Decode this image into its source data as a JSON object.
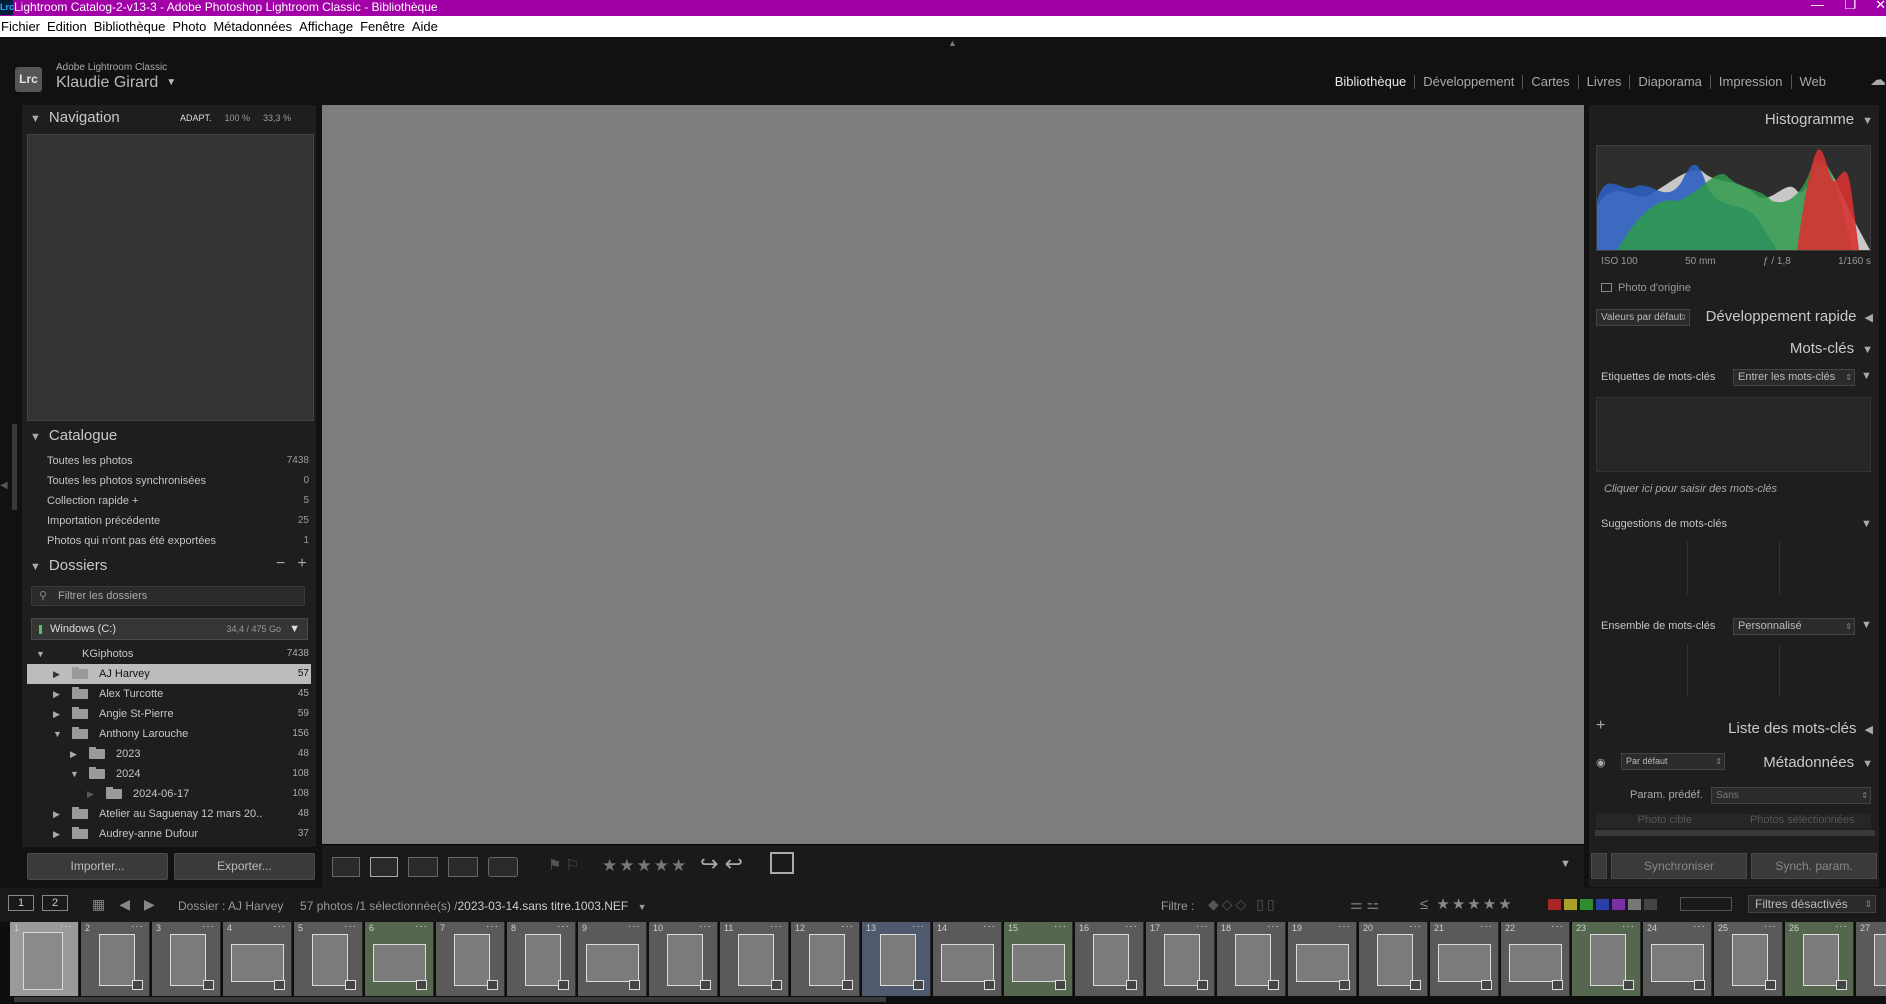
{
  "window": {
    "title": "Lightroom Catalog-2-v13-3 - Adobe Photoshop Lightroom Classic - Bibliothèque",
    "app_icon": "Lrc"
  },
  "menu": [
    "Fichier",
    "Edition",
    "Bibliothèque",
    "Photo",
    "Métadonnées",
    "Affichage",
    "Fenêtre",
    "Aide"
  ],
  "identity": {
    "product": "Adobe Lightroom Classic",
    "user": "Klaudie Girard",
    "logo": "Lrc"
  },
  "modules": [
    "Bibliothèque",
    "Développement",
    "Cartes",
    "Livres",
    "Diaporama",
    "Impression",
    "Web"
  ],
  "navigator": {
    "title": "Navigation",
    "zoom": [
      "ADAPT.",
      "100 %",
      "33,3 %"
    ]
  },
  "catalog": {
    "title": "Catalogue",
    "items": [
      {
        "label": "Toutes les photos",
        "count": "7438"
      },
      {
        "label": "Toutes les photos synchronisées",
        "count": "0"
      },
      {
        "label": "Collection rapide +",
        "count": "5"
      },
      {
        "label": "Importation précédente",
        "count": "25"
      },
      {
        "label": "Photos qui n'ont pas été exportées",
        "count": "1"
      }
    ]
  },
  "folders": {
    "title": "Dossiers",
    "filter_placeholder": "Filtrer les dossiers",
    "volume": {
      "name": "Windows (C:)",
      "space": "34,4 / 475 Go"
    },
    "tree": [
      {
        "label": "KGiphotos",
        "count": "7438"
      },
      {
        "label": "AJ Harvey",
        "count": "57"
      },
      {
        "label": "Alex Turcotte",
        "count": "45"
      },
      {
        "label": "Angie St-Pierre",
        "count": "59"
      },
      {
        "label": "Anthony Larouche",
        "count": "156"
      },
      {
        "label": "2023",
        "count": "48"
      },
      {
        "label": "2024",
        "count": "108"
      },
      {
        "label": "2024-06-17",
        "count": "108"
      },
      {
        "label": "Atelier au Saguenay 12 mars 20..",
        "count": "48"
      },
      {
        "label": "Audrey-anne Dufour",
        "count": "37"
      }
    ]
  },
  "left_buttons": {
    "import": "Importer...",
    "export": "Exporter..."
  },
  "histogram": {
    "title": "Histogramme",
    "iso": "ISO 100",
    "focal": "50 mm",
    "aperture": "ƒ / 1,8",
    "shutter": "1/160 s",
    "original": "Photo d'origine"
  },
  "quick_develop": {
    "title": "Développement rapide",
    "preset": "Valeurs par défaut"
  },
  "keywords": {
    "title": "Mots-clés",
    "tags_label": "Etiquettes de mots-clés",
    "tags_select": "Entrer les mots-clés",
    "hint": "Cliquer ici pour saisir des mots-clés",
    "suggestions": "Suggestions de mots-clés",
    "set_label": "Ensemble de mots-clés",
    "set_select": "Personnalisé"
  },
  "keyword_list": {
    "title": "Liste des mots-clés"
  },
  "metadata": {
    "title": "Métadonnées",
    "preset": "Par défaut",
    "param_label": "Param. prédéf.",
    "param_value": "Sans",
    "target": "Photo cible",
    "selected": "Photos sélectionnées"
  },
  "sync": {
    "sync": "Synchroniser",
    "sync_settings": "Synch. param."
  },
  "filmbar": {
    "views": [
      "1",
      "2"
    ],
    "source_prefix": "Dossier : AJ Harvey",
    "count": "57 photos /1 sélectionnée(s) /",
    "filename": "2023-03-14.sans titre.1003.NEF",
    "filter_label": "Filtre :",
    "filter_state": "Filtres désactivés"
  },
  "filmstrip": [
    "1",
    "2",
    "3",
    "4",
    "5",
    "6",
    "7",
    "8",
    "9",
    "10",
    "11",
    "12",
    "13",
    "14",
    "15",
    "16",
    "17",
    "18",
    "19",
    "20",
    "21",
    "22",
    "23",
    "24",
    "25",
    "26",
    "27"
  ],
  "colors": {
    "titlebar": "#a000a5",
    "canvas": "#7e7e7e",
    "panel": "#1e1e1e"
  }
}
